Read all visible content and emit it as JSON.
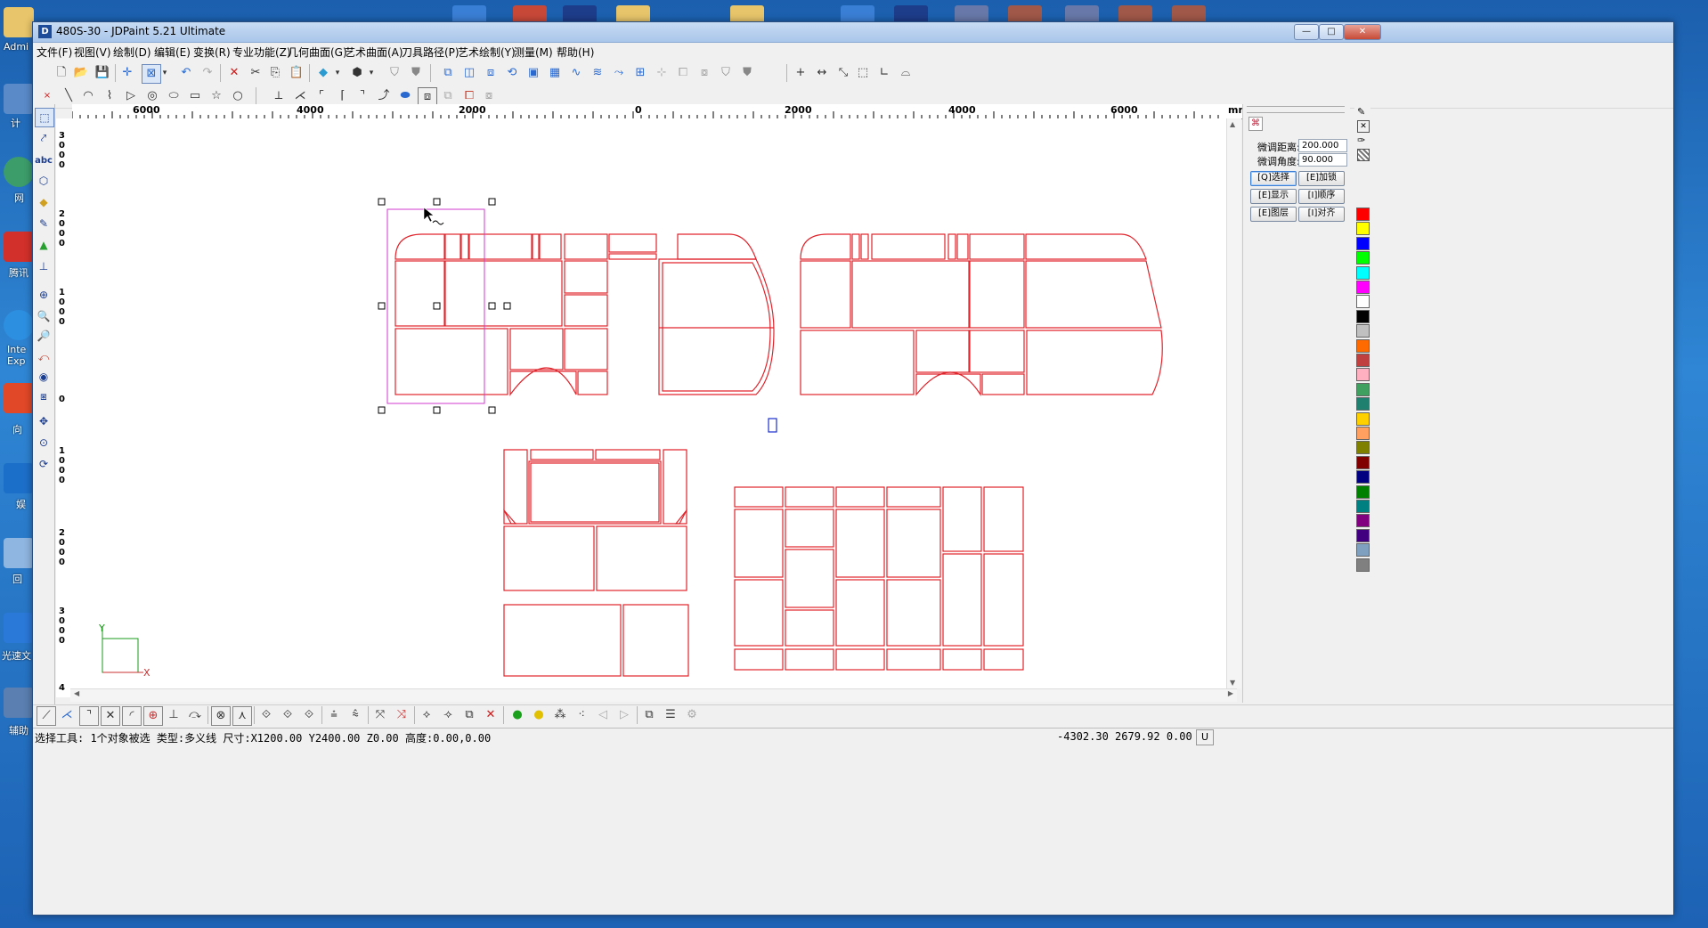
{
  "window": {
    "title": "480S-30 - JDPaint 5.21 Ultimate",
    "controls": [
      "—",
      "□",
      "✕"
    ]
  },
  "menu": [
    "文件(F)",
    "视图(V)",
    "绘制(D)",
    "编辑(E)",
    "变换(R)",
    "专业功能(Z)",
    "几何曲面(G)",
    "艺术曲面(A)",
    "刀具路径(P)",
    "艺术绘制(Y)",
    "测量(M)",
    "帮助(H)"
  ],
  "ruler": {
    "unit": "mm",
    "h_labels": [
      "6000",
      "4000",
      "2000",
      "0",
      "2000",
      "4000",
      "6000"
    ],
    "v_labels": [
      "3000",
      "2000",
      "1000",
      "0",
      "1000",
      "2000",
      "3000",
      "4"
    ]
  },
  "right_panel": {
    "fine_distance_label": "微调距离:",
    "fine_distance_value": "200.000",
    "fine_angle_label": "微调角度:",
    "fine_angle_value": "90.000",
    "buttons": [
      "[Q]选择",
      "[E]加锁",
      "[E]显示",
      "[I]顺序",
      "[E]图层",
      "[I]对齐"
    ]
  },
  "palette": [
    "#ff0000",
    "#ffff00",
    "#0000ff",
    "#00ff00",
    "#00ffff",
    "#ff00ff",
    "#ffffff",
    "#000000",
    "#c0c0c0",
    "#ff6a00",
    "#c04040",
    "#ffb0c0",
    "#40a060",
    "#208070",
    "#ffd000",
    "#ffa060",
    "#808000",
    "#800000",
    "#000080",
    "#008000",
    "#008080",
    "#800080",
    "#400080",
    "#80a0c0",
    "#808080"
  ],
  "canvas": {
    "axis_y": "Y",
    "axis_x": "X"
  },
  "status": {
    "text": "选择工具: 1个对象被选 类型:多义线 尺寸:X1200.00 Y2400.00 Z0.00 高度:0.00,0.00",
    "coords": "-4302.30 2679.92 0.00",
    "unit_btn": "U"
  },
  "desktop": {
    "labels": [
      "Admi",
      "计",
      "网",
      "腾讯",
      "Inte Exp",
      "向",
      "娱",
      "回",
      "光速文",
      "辅助"
    ]
  },
  "accent_red": "#e0242c",
  "select_magenta": "#d23ad2"
}
